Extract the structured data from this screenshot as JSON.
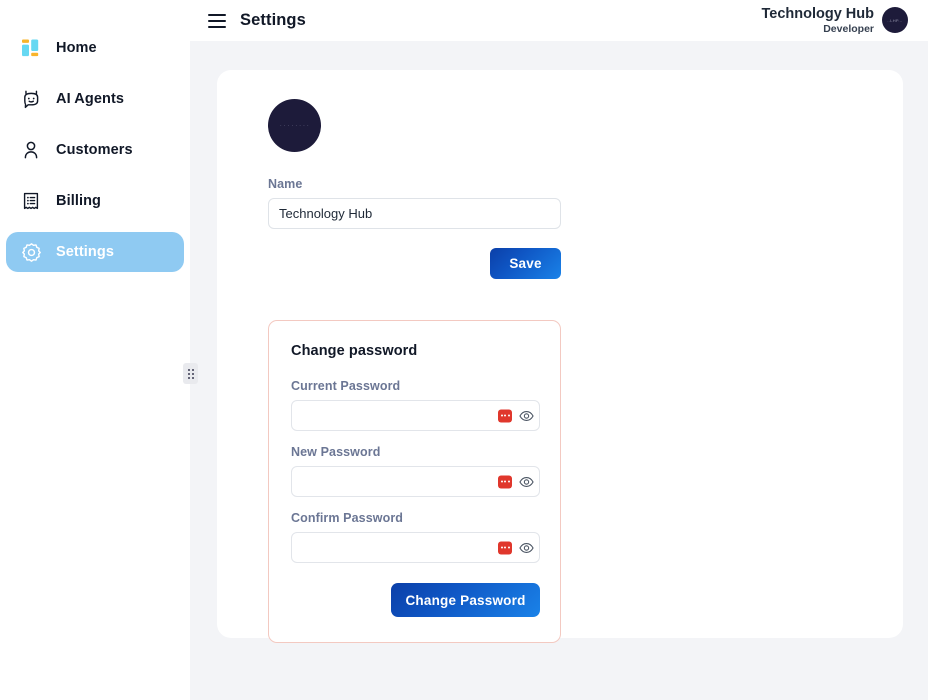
{
  "sidebar": {
    "items": [
      {
        "label": "Home",
        "icon": "dashboard-grid-icon",
        "active": false
      },
      {
        "label": "AI Agents",
        "icon": "robot-icon",
        "active": false
      },
      {
        "label": "Customers",
        "icon": "user-icon",
        "active": false
      },
      {
        "label": "Billing",
        "icon": "invoice-icon",
        "active": false
      },
      {
        "label": "Settings",
        "icon": "gear-icon",
        "active": true
      }
    ],
    "resize_handle_icon": "grip-dots-icon"
  },
  "topbar": {
    "menu_icon": "hamburger-menu-icon",
    "title": "Settings",
    "user_name": "Technology Hub",
    "user_role": "Developer",
    "avatar_icon": "user-avatar",
    "avatar_text": "..LHP..."
  },
  "profile": {
    "avatar_icon": "organization-avatar",
    "avatar_text": "· · · · ·  · · ·",
    "name_label": "Name",
    "name_value": "Technology Hub",
    "name_placeholder": "Name",
    "save_label": "Save"
  },
  "change_password": {
    "title": "Change password",
    "fields": [
      {
        "label": "Current Password",
        "value": "",
        "placeholder": "",
        "password_manager_icon": "password-manager-icon",
        "reveal_icon": "eye-icon"
      },
      {
        "label": "New Password",
        "value": "",
        "placeholder": "",
        "password_manager_icon": "password-manager-icon",
        "reveal_icon": "eye-icon"
      },
      {
        "label": "Confirm Password",
        "value": "",
        "placeholder": "",
        "password_manager_icon": "password-manager-icon",
        "reveal_icon": "eye-icon"
      }
    ],
    "submit_label": "Change Password"
  },
  "colors": {
    "page_background": "#f3f4f7",
    "panel_background": "#ffffff",
    "sidebar_active": "#8fcaf2",
    "accent_blue_dark": "#0b3fa8",
    "accent_blue_light": "#1a82e8",
    "card_border_pink": "#f3c9c1",
    "password_manager_red": "#e0372c",
    "avatar_navy": "#1d1b3a",
    "label_gray": "#6b7694",
    "icon_cyan": "#66d8f2",
    "icon_yellow": "#f9b42b"
  }
}
